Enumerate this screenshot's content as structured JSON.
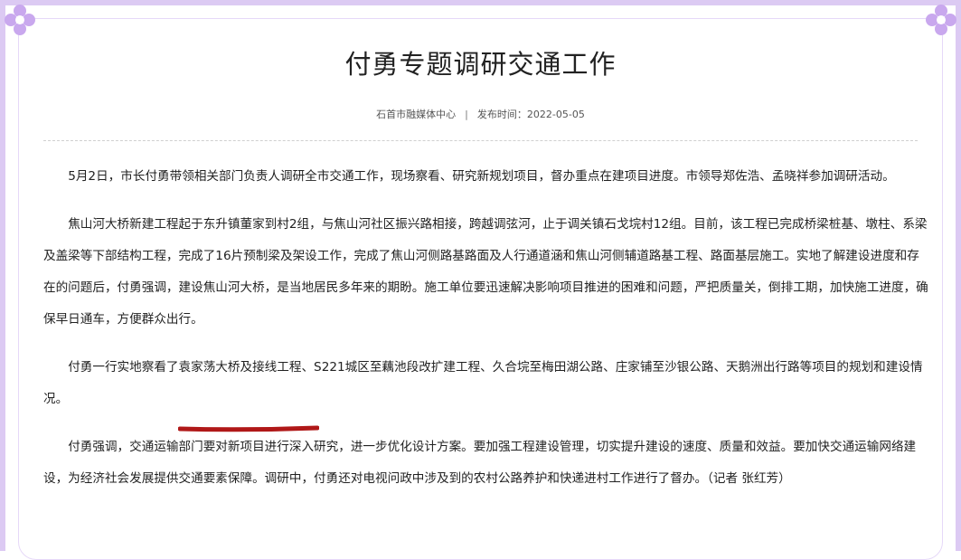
{
  "article": {
    "title": "付勇专题调研交通工作",
    "source": "石首市融媒体中心",
    "separator": "|",
    "publish_time": "发布时间：2022-05-05",
    "paragraphs": [
      "5月2日，市长付勇带领相关部门负责人调研全市交通工作，现场察看、研究新规划项目，督办重点在建项目进度。市领导郑佐浩、孟晓祥参加调研活动。",
      "焦山河大桥新建工程起于东升镇董家到村2组，与焦山河社区振兴路相接，跨越调弦河，止于调关镇石戈垸村12组。目前，该工程已完成桥梁桩基、墩柱、系梁及盖梁等下部结构工程，完成了16片预制梁及架设工作，完成了焦山河侧路基路面及人行通道涵和焦山河侧辅道路基工程、路面基层施工。实地了解建设进度和存在的问题后，付勇强调，建设焦山河大桥，是当地居民多年来的期盼。施工单位要迅速解决影响项目推进的困难和问题，严把质量关，倒排工期，加快施工进度，确保早日通车，方便群众出行。",
      "付勇一行实地察看了袁家荡大桥及接线工程、S221城区至藕池段改扩建工程、久合垸至梅田湖公路、庄家铺至沙银公路、天鹅洲出行路等项目的规划和建设情况。",
      "付勇强调，交通运输部门要对新项目进行深入研究，进一步优化设计方案。要加强工程建设管理，切实提升建设的速度、质量和效益。要加快交通运输网络建设，为经济社会发展提供交通要素保障。调研中，付勇还对电视问政中涉及到的农村公路养护和快递进村工作进行了督办。（记者 张红芳）"
    ]
  },
  "colors": {
    "frame": "#dccaf3",
    "corner_flower": "#c9a8ee",
    "underline": "#b01818"
  },
  "icons": {
    "corner_left": "flower-icon",
    "corner_right": "flower-icon"
  }
}
